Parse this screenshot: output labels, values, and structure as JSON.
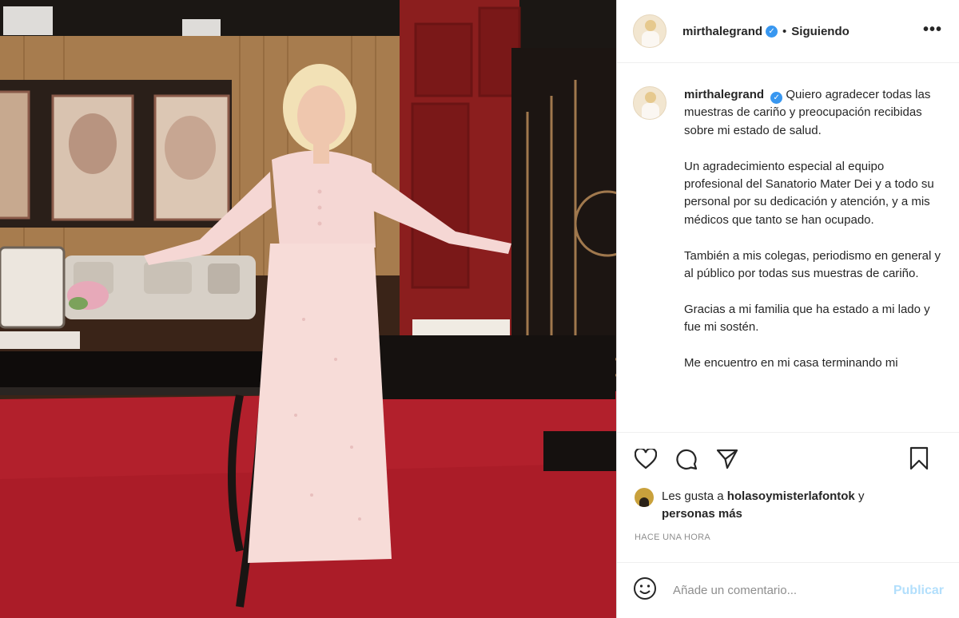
{
  "post": {
    "username": "mirthalegrand",
    "follow_status": "Siguiendo",
    "separator": "•",
    "more_label": "•••",
    "caption": "Quiero agradecer todas las muestras de cariño y preocupación recibidas sobre mi estado de salud.\n\nUn agradecimiento especial al equipo profesional del Sanatorio Mater Dei y a todo su personal por su dedicación y atención, y a mis médicos que tanto se han ocupado.\n\nTambién a mis colegas, periodismo en general y al público por todas sus muestras de cariño.\n\nGracias a mi familia que ha estado a mi lado y fue mi sostén.\n\nMe encuentro en mi casa terminando mi",
    "likes_prefix": "Les gusta a ",
    "likes_user": "holasoymisterlafontok",
    "likes_suffix": " y",
    "likes_others": "personas más",
    "timestamp": "HACE UNA HORA",
    "comment_placeholder": "Añade un comentario...",
    "publish_label": "Publicar"
  },
  "icons": {
    "verified": "verified-badge-icon",
    "like": "heart-icon",
    "comment": "comment-icon",
    "share": "paper-plane-icon",
    "save": "bookmark-icon",
    "emoji": "emoji-icon"
  },
  "colors": {
    "verified": "#3897f0",
    "publish_disabled": "#b2dffc",
    "muted": "#8e8e8e"
  }
}
